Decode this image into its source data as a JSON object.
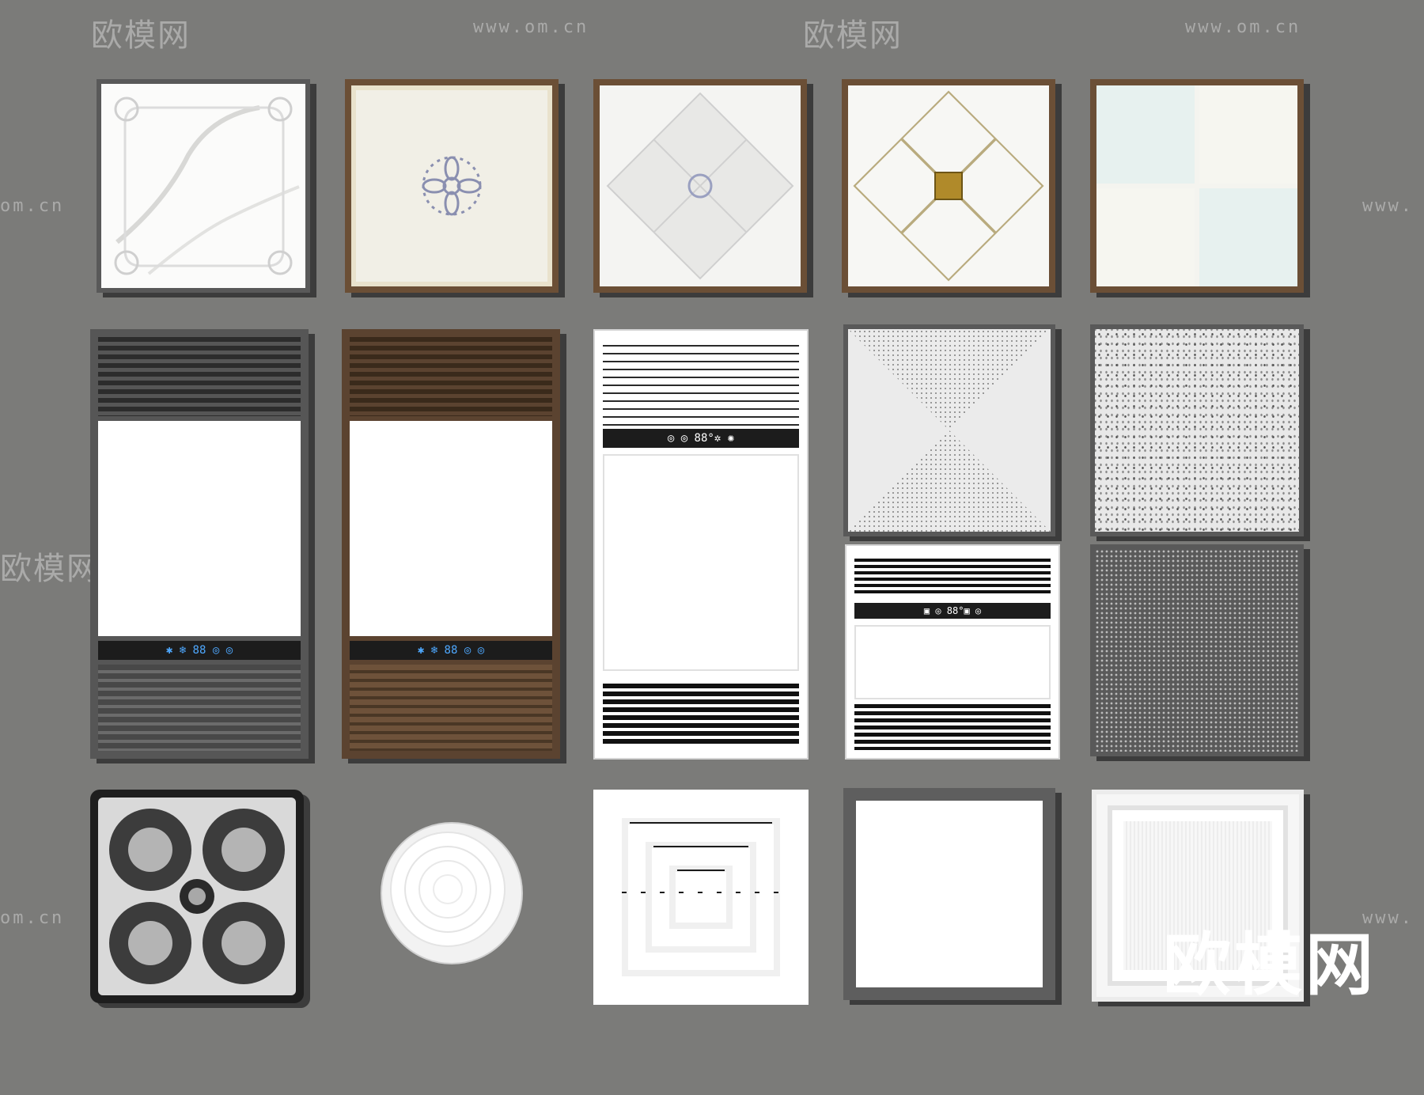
{
  "watermark": {
    "logo_text": "欧模网",
    "url_text": "www.om.cn",
    "url_partial": "om.cn",
    "url_prefix": "www.",
    "logo_partial": "欧模网"
  },
  "brand_mark": "欧模网",
  "heater_display": {
    "blue_unit": "✱ ❄ 88 ◎ ◎",
    "white_unit_a": "◎ ◎ 88°✲ ✺",
    "white_unit_b": "▣ ◎ 88°▣ ◎"
  },
  "colors": {
    "background": "#7b7b79",
    "frame_brown": "#6b4f36",
    "frame_gray": "#595959",
    "accent_gold": "#b08a2a",
    "display_blue": "#4ea8ff"
  }
}
